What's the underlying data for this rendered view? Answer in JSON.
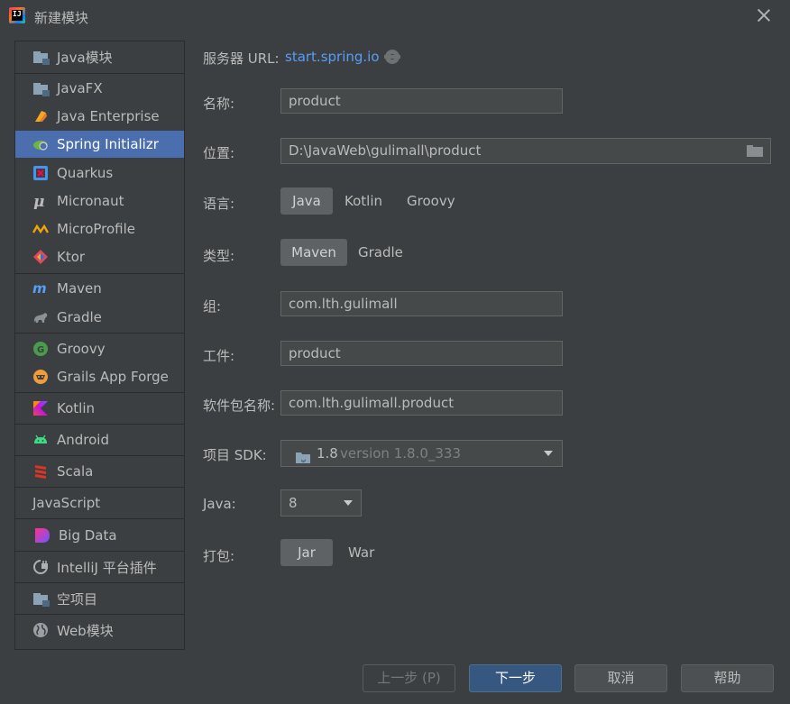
{
  "window": {
    "title": "新建模块"
  },
  "sidebar": {
    "items": [
      {
        "label": "Java模块",
        "icon": "folder-icon"
      },
      {
        "label": "JavaFX",
        "icon": "folder-icon"
      },
      {
        "label": "Java Enterprise",
        "icon": "java-enterprise-icon"
      },
      {
        "label": "Spring Initializr",
        "icon": "spring-icon",
        "selected": true
      },
      {
        "label": "Quarkus",
        "icon": "quarkus-icon"
      },
      {
        "label": "Micronaut",
        "icon": "micronaut-icon"
      },
      {
        "label": "MicroProfile",
        "icon": "microprofile-icon"
      },
      {
        "label": "Ktor",
        "icon": "ktor-icon"
      },
      {
        "label": "Maven",
        "icon": "maven-icon"
      },
      {
        "label": "Gradle",
        "icon": "gradle-icon"
      },
      {
        "label": "Groovy",
        "icon": "groovy-icon"
      },
      {
        "label": "Grails App Forge",
        "icon": "grails-icon"
      },
      {
        "label": "Kotlin",
        "icon": "kotlin-icon"
      },
      {
        "label": "Android",
        "icon": "android-icon"
      },
      {
        "label": "Scala",
        "icon": "scala-icon"
      },
      {
        "label": "JavaScript",
        "icon": ""
      },
      {
        "label": "Big Data",
        "icon": "big-data-icon"
      },
      {
        "label": "IntelliJ 平台插件",
        "icon": "plugin-icon"
      },
      {
        "label": "空项目",
        "icon": "folder-icon"
      },
      {
        "label": "Web模块",
        "icon": "globe-icon"
      }
    ]
  },
  "form": {
    "server_url_label": "服务器 URL:",
    "server_url_value": "start.spring.io",
    "name_label": "名称:",
    "name_value": "product",
    "location_label": "位置:",
    "location_value": "D:\\JavaWeb\\gulimall\\product",
    "language_label": "语言:",
    "language_options": [
      "Java",
      "Kotlin",
      "Groovy"
    ],
    "language_selected": "Java",
    "type_label": "类型:",
    "type_options": [
      "Maven",
      "Gradle"
    ],
    "type_selected": "Maven",
    "group_label": "组:",
    "group_value": "com.lth.gulimall",
    "artifact_label": "工件:",
    "artifact_value": "product",
    "package_label": "软件包名称:",
    "package_value": "com.lth.gulimall.product",
    "sdk_label": "项目 SDK:",
    "sdk_value": "1.8",
    "sdk_version": "version 1.8.0_333",
    "java_label": "Java:",
    "java_value": "8",
    "packaging_label": "打包:",
    "packaging_options": [
      "Jar",
      "War"
    ],
    "packaging_selected": "Jar"
  },
  "footer": {
    "prev_label": "上一步 (P)",
    "next_label": "下一步",
    "cancel_label": "取消",
    "help_label": "帮助"
  },
  "colors": {
    "accent": "#4b6eaf",
    "link": "#589df6",
    "background": "#3c3f41"
  }
}
